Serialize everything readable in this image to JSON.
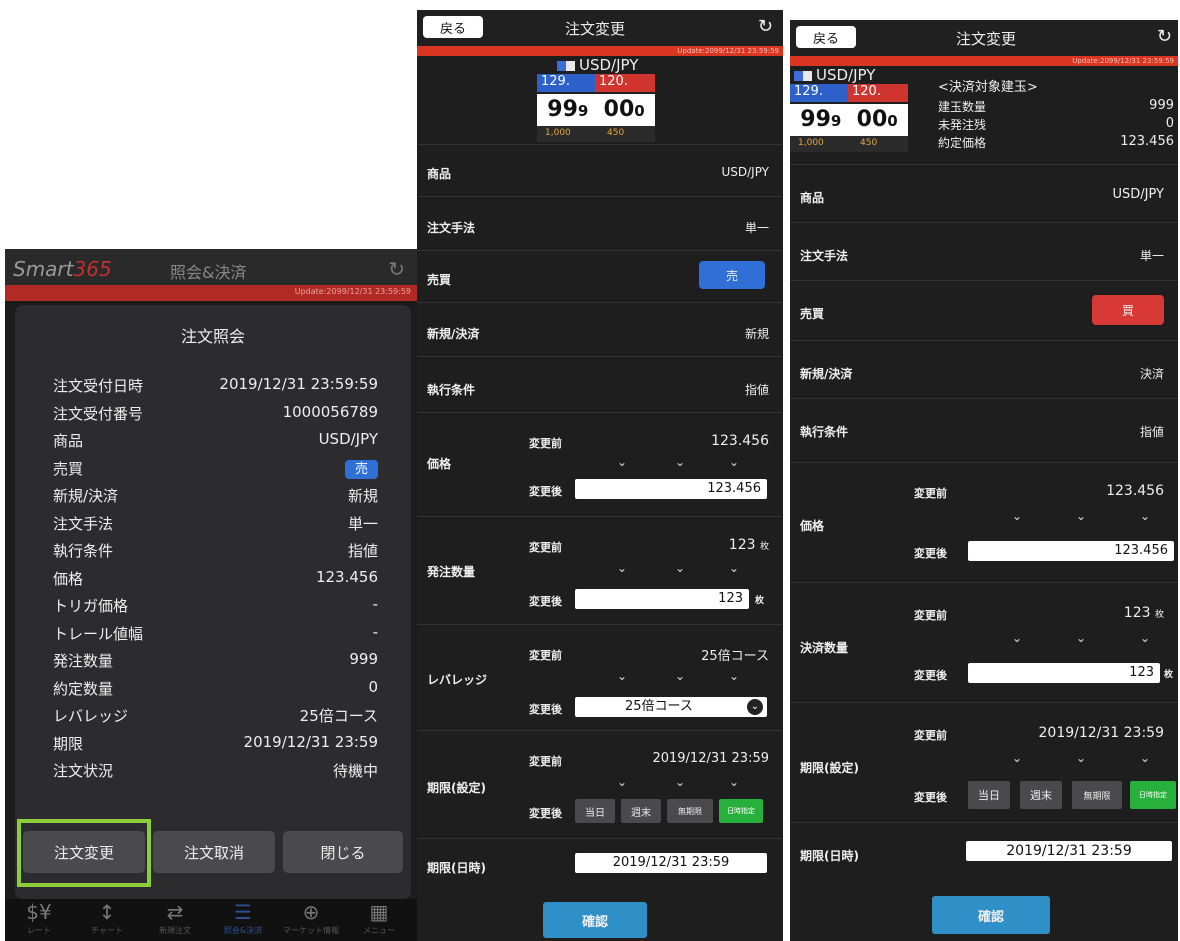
{
  "colors": {
    "accent_blue": "#2f6fd6",
    "accent_red": "#d93520",
    "highlight_green": "#8ccd3a",
    "button_green": "#27b03b",
    "confirm_blue": "#2f8fc7"
  },
  "left": {
    "app_name_prefix": "Smart",
    "app_name_suffix": "365",
    "header_title": "照会&決済",
    "update_text": "Update:2099/12/31 23:59:59",
    "modal_title": "注文照会",
    "rows": [
      {
        "label": "注文受付日時",
        "value": "2019/12/31 23:59:59"
      },
      {
        "label": "注文受付番号",
        "value": "1000056789"
      },
      {
        "label": "商品",
        "value": "USD/JPY"
      },
      {
        "label": "売買",
        "value": "売"
      },
      {
        "label": "新規/決済",
        "value": "新規"
      },
      {
        "label": "注文手法",
        "value": "単一"
      },
      {
        "label": "執行条件",
        "value": "指値"
      },
      {
        "label": "価格",
        "value": "123.456"
      },
      {
        "label": "トリガ価格",
        "value": "-"
      },
      {
        "label": "トレール値幅",
        "value": "-"
      },
      {
        "label": "発注数量",
        "value": "999"
      },
      {
        "label": "約定数量",
        "value": "0"
      },
      {
        "label": "レバレッジ",
        "value": "25倍コース"
      },
      {
        "label": "期限",
        "value": "2019/12/31 23:59"
      },
      {
        "label": "注文状況",
        "value": "待機中"
      }
    ],
    "buttons": {
      "change": "注文変更",
      "cancel": "注文取消",
      "close": "閉じる"
    },
    "tabs": [
      {
        "label": "レート",
        "icon": "currency-icon"
      },
      {
        "label": "チャート",
        "icon": "chart-icon"
      },
      {
        "label": "新規注文",
        "icon": "arrows-icon"
      },
      {
        "label": "照会&決済",
        "icon": "database-icon"
      },
      {
        "label": "マーケット情報",
        "icon": "globe-icon"
      },
      {
        "label": "メニュー",
        "icon": "grid-icon"
      }
    ]
  },
  "mid": {
    "back": "戻る",
    "title": "注文変更",
    "update_text": "Update:2099/12/31 23:59:59",
    "quote": {
      "pair": "USD/JPY",
      "bid_head": "129.",
      "ask_head": "120.",
      "bid_big": "99",
      "bid_sub": "9",
      "ask_big": "00",
      "ask_sub": "0",
      "qty_bid": "1,000",
      "qty_ask": "450"
    },
    "fields": {
      "product": {
        "label": "商品",
        "value": "USD/JPY"
      },
      "method": {
        "label": "注文手法",
        "value": "単一"
      },
      "side": {
        "label": "売買",
        "value": "売"
      },
      "new_close": {
        "label": "新規/決済",
        "value": "新規"
      },
      "condition": {
        "label": "執行条件",
        "value": "指値"
      }
    },
    "price": {
      "label": "価格",
      "before_label": "変更前",
      "before": "123.456",
      "after_label": "変更後",
      "after": "123.456"
    },
    "qty": {
      "label": "発注数量",
      "before_label": "変更前",
      "before": "123",
      "after_label": "変更後",
      "after": "123",
      "unit": "枚"
    },
    "leverage": {
      "label": "レバレッジ",
      "before_label": "変更前",
      "before": "25倍コース",
      "after_label": "変更後",
      "after": "25倍コース"
    },
    "expiry": {
      "label": "期限(設定)",
      "before_label": "変更前",
      "before": "2019/12/31 23:59",
      "after_label": "変更後",
      "opt_today": "当日",
      "opt_weekend": "週末",
      "opt_none": "無期限",
      "opt_datetime": "日時指定"
    },
    "expiry_dt": {
      "label": "期限(日時)",
      "value": "2019/12/31 23:59"
    },
    "confirm": "確認"
  },
  "right": {
    "back": "戻る",
    "title": "注文変更",
    "update_text": "Update:2099/12/31 23:59:59",
    "quote": {
      "pair": "USD/JPY",
      "bid_head": "129.",
      "ask_head": "120.",
      "bid_big": "99",
      "bid_sub": "9",
      "ask_big": "00",
      "ask_sub": "0",
      "qty_bid": "1,000",
      "qty_ask": "450"
    },
    "position": {
      "title": "<決済対象建玉>",
      "qty_label": "建玉数量",
      "qty": "999",
      "unfilled_label": "未発注残",
      "unfilled": "0",
      "price_label": "約定価格",
      "price": "123.456"
    },
    "fields": {
      "product": {
        "label": "商品",
        "value": "USD/JPY"
      },
      "method": {
        "label": "注文手法",
        "value": "単一"
      },
      "side": {
        "label": "売買",
        "value": "買"
      },
      "new_close": {
        "label": "新規/決済",
        "value": "決済"
      },
      "condition": {
        "label": "執行条件",
        "value": "指値"
      }
    },
    "price": {
      "label": "価格",
      "before_label": "変更前",
      "before": "123.456",
      "after_label": "変更後",
      "after": "123.456"
    },
    "qty": {
      "label": "決済数量",
      "before_label": "変更前",
      "before": "123",
      "after_label": "変更後",
      "after": "123",
      "unit": "枚"
    },
    "expiry": {
      "label": "期限(設定)",
      "before_label": "変更前",
      "before": "2019/12/31 23:59",
      "after_label": "変更後",
      "opt_today": "当日",
      "opt_weekend": "週末",
      "opt_none": "無期限",
      "opt_datetime": "日時指定"
    },
    "expiry_dt": {
      "label": "期限(日時)",
      "value": "2019/12/31 23:59"
    },
    "confirm": "確認"
  }
}
